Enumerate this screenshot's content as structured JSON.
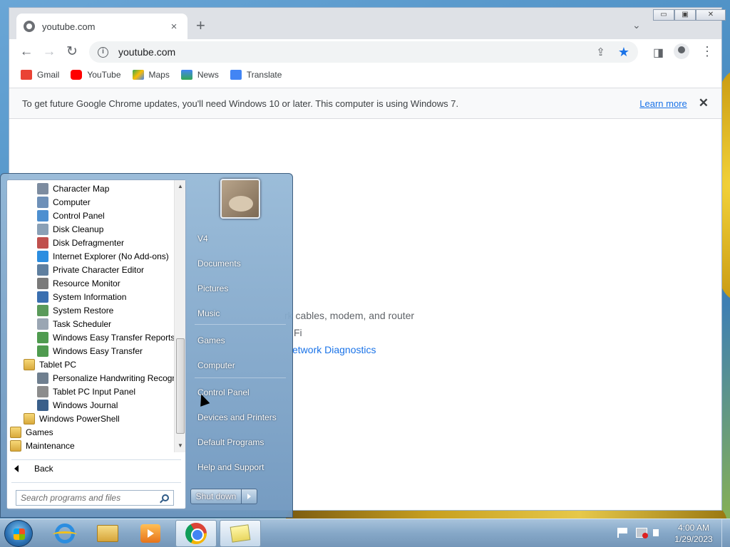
{
  "browser": {
    "tab_title": "youtube.com",
    "tab_close_glyph": "×",
    "new_tab_glyph": "+",
    "tab_search_glyph": "⌄",
    "window_controls": [
      "▭",
      "▣",
      "✕"
    ],
    "back_glyph": "←",
    "forward_glyph": "→",
    "reload_glyph": "↻",
    "url": "youtube.com",
    "share_glyph": "⇪",
    "star_glyph": "★",
    "sidepanel_glyph": "◨",
    "menu_glyph": "⋮",
    "bookmarks": [
      {
        "label": "Gmail",
        "color": "#ea4335"
      },
      {
        "label": "YouTube",
        "color": "#ff0000"
      },
      {
        "label": "Maps",
        "color": "#34a853"
      },
      {
        "label": "News",
        "color": "#4285f4"
      },
      {
        "label": "Translate",
        "color": "#4285f4"
      }
    ],
    "infobar": {
      "message": "To get future Google Chrome updates, you'll need Windows 10 or later. This computer is using Windows 7.",
      "link": "Learn more",
      "close_glyph": "✕"
    },
    "page": {
      "line1": "rk cables, modem, and router",
      "line2": "Fi",
      "link": "etwork Diagnostics"
    }
  },
  "start_menu": {
    "programs": [
      {
        "label": "Character Map",
        "indent": 2,
        "icon": "charmap-icon",
        "color": "#7d8ca0"
      },
      {
        "label": "Computer",
        "indent": 2,
        "icon": "computer-icon",
        "color": "#6e90b8"
      },
      {
        "label": "Control Panel",
        "indent": 2,
        "icon": "control-panel-icon",
        "color": "#4d8fd0"
      },
      {
        "label": "Disk Cleanup",
        "indent": 2,
        "icon": "disk-cleanup-icon",
        "color": "#8aa0b6"
      },
      {
        "label": "Disk Defragmenter",
        "indent": 2,
        "icon": "defrag-icon",
        "color": "#c0504d"
      },
      {
        "label": "Internet Explorer (No Add-ons)",
        "indent": 2,
        "icon": "ie-icon",
        "color": "#2b8de0"
      },
      {
        "label": "Private Character Editor",
        "indent": 2,
        "icon": "char-editor-icon",
        "color": "#5f7f9f"
      },
      {
        "label": "Resource Monitor",
        "indent": 2,
        "icon": "resource-monitor-icon",
        "color": "#7a7a7a"
      },
      {
        "label": "System Information",
        "indent": 2,
        "icon": "sysinfo-icon",
        "color": "#3a6fb0"
      },
      {
        "label": "System Restore",
        "indent": 2,
        "icon": "restore-icon",
        "color": "#5a9a5a"
      },
      {
        "label": "Task Scheduler",
        "indent": 2,
        "icon": "clock-icon",
        "color": "#9aa6b3"
      },
      {
        "label": "Windows Easy Transfer Reports",
        "indent": 2,
        "icon": "easy-transfer-icon",
        "color": "#4f9b4f"
      },
      {
        "label": "Windows Easy Transfer",
        "indent": 2,
        "icon": "easy-transfer-icon",
        "color": "#4f9b4f"
      },
      {
        "label": "Tablet PC",
        "indent": 1,
        "icon": "folder-icon",
        "folder": true
      },
      {
        "label": "Personalize Handwriting Recognition",
        "indent": 2,
        "icon": "handwriting-icon",
        "color": "#6f7f8f"
      },
      {
        "label": "Tablet PC Input Panel",
        "indent": 2,
        "icon": "tablet-input-icon",
        "color": "#8c8c8c"
      },
      {
        "label": "Windows Journal",
        "indent": 2,
        "icon": "journal-icon",
        "color": "#3a5f8a"
      },
      {
        "label": "Windows PowerShell",
        "indent": 1,
        "icon": "folder-icon",
        "folder": true
      },
      {
        "label": "Games",
        "indent": 0,
        "icon": "folder-icon",
        "folder": true
      },
      {
        "label": "Maintenance",
        "indent": 0,
        "icon": "folder-icon",
        "folder": true
      }
    ],
    "back_label": "Back",
    "search_placeholder": "Search programs and files",
    "right_items": [
      {
        "label": "V4"
      },
      {
        "label": "Documents"
      },
      {
        "label": "Pictures"
      },
      {
        "label": "Music"
      },
      {
        "label": "Games"
      },
      {
        "label": "Computer"
      },
      {
        "label": "Control Panel"
      },
      {
        "label": "Devices and Printers"
      },
      {
        "label": "Default Programs"
      },
      {
        "label": "Help and Support"
      }
    ],
    "shutdown_label": "Shut down"
  },
  "taskbar": {
    "time": "4:00 AM",
    "date": "1/29/2023"
  }
}
